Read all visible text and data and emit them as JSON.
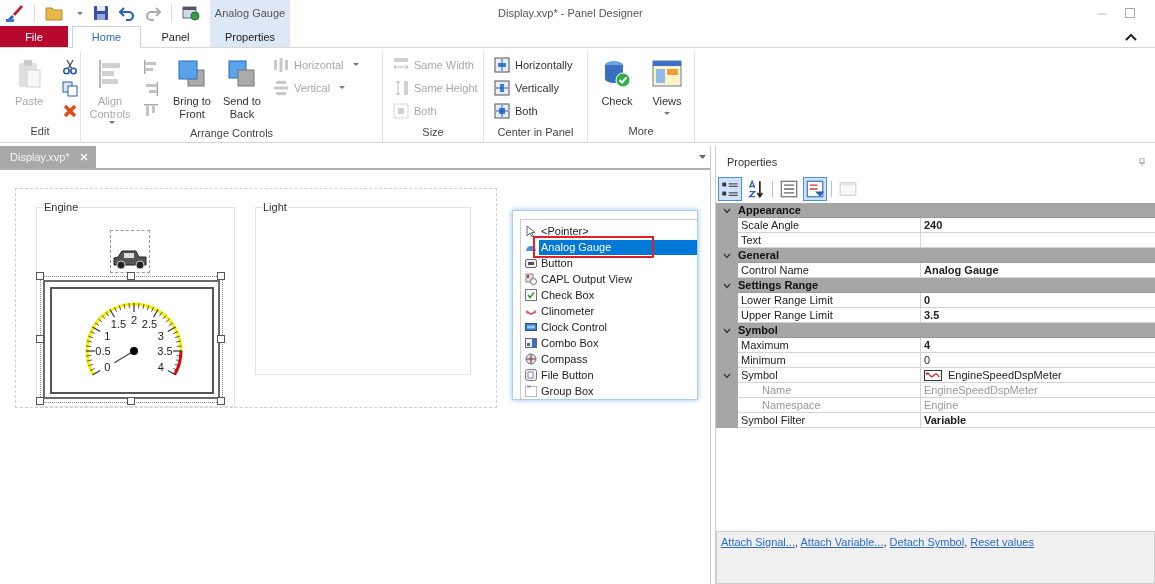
{
  "window": {
    "title": "Display.xvp* - Panel Designer",
    "contextual_tab": "Analog Gauge"
  },
  "ribbon_tabs": [
    {
      "label": "File",
      "kind": "file",
      "selected": false
    },
    {
      "label": "Home",
      "kind": "normal",
      "selected": true
    },
    {
      "label": "Panel",
      "kind": "normal",
      "selected": false
    },
    {
      "label": "Properties",
      "kind": "contextual",
      "selected": false
    }
  ],
  "ribbon_groups": [
    {
      "label": "Edit",
      "columns": [
        [
          {
            "kind": "large",
            "label": "Paste",
            "disabled": true,
            "dropdown": false
          }
        ],
        [
          {
            "kind": "icon",
            "disabled": false
          },
          {
            "kind": "icon",
            "disabled": false
          },
          {
            "kind": "icon",
            "disabled": false
          }
        ]
      ]
    },
    {
      "label": "Arrange Controls",
      "columns": [
        [
          {
            "kind": "large",
            "label": "Align Controls",
            "disabled": true,
            "dropdown": true
          }
        ],
        [
          {
            "kind": "icon",
            "disabled": true
          },
          {
            "kind": "icon",
            "disabled": true
          },
          {
            "kind": "icon",
            "disabled": true
          }
        ],
        [
          {
            "kind": "large",
            "label": "Bring to Front",
            "disabled": false,
            "dropdown": false
          }
        ],
        [
          {
            "kind": "large",
            "label": "Send to Back",
            "disabled": false,
            "dropdown": false
          }
        ],
        [
          {
            "kind": "small",
            "label": "Horizontal",
            "disabled": true,
            "dropdown": true
          },
          {
            "kind": "small",
            "label": "Vertical",
            "disabled": true,
            "dropdown": true
          }
        ]
      ]
    },
    {
      "label": "Size",
      "columns": [
        [
          {
            "kind": "small",
            "label": "Same Width",
            "disabled": true,
            "dropdown": false
          },
          {
            "kind": "small",
            "label": "Same Height",
            "disabled": true,
            "dropdown": false
          },
          {
            "kind": "small",
            "label": "Both",
            "disabled": true,
            "dropdown": false
          }
        ]
      ]
    },
    {
      "label": "Center in Panel",
      "columns": [
        [
          {
            "kind": "small",
            "label": "Horizontally",
            "disabled": false,
            "dropdown": false
          },
          {
            "kind": "small",
            "label": "Vertically",
            "disabled": false,
            "dropdown": false
          },
          {
            "kind": "small",
            "label": "Both",
            "disabled": false,
            "dropdown": false
          }
        ]
      ]
    },
    {
      "label": "More",
      "columns": [
        [
          {
            "kind": "large",
            "label": "Check",
            "disabled": false,
            "dropdown": false
          }
        ],
        [
          {
            "kind": "large",
            "label": "Views",
            "disabled": false,
            "dropdown": true
          }
        ]
      ]
    }
  ],
  "document_tabs": [
    {
      "label": "Display.xvp*",
      "selected": true
    }
  ],
  "group_boxes": [
    {
      "label": "Engine",
      "has_image": true,
      "gauge": {
        "scale_labels": [
          "2",
          "1.5",
          "2.5",
          "1",
          "3",
          "0.5",
          "3.5",
          "0",
          "4"
        ],
        "selected": true
      }
    },
    {
      "label": "Light",
      "has_image": false
    }
  ],
  "toolbox": {
    "items": [
      {
        "label": "<Pointer>",
        "selected": false
      },
      {
        "label": "Analog Gauge",
        "selected": true
      },
      {
        "label": "Button",
        "selected": false
      },
      {
        "label": "CAPL Output View",
        "selected": false
      },
      {
        "label": "Check Box",
        "selected": false
      },
      {
        "label": "Clinometer",
        "selected": false
      },
      {
        "label": "Clock Control",
        "selected": false
      },
      {
        "label": "Combo Box",
        "selected": false
      },
      {
        "label": "Compass",
        "selected": false
      },
      {
        "label": "File Button",
        "selected": false
      },
      {
        "label": "Group Box",
        "selected": false
      }
    ]
  },
  "properties": {
    "title": "Properties",
    "toolbar": [
      {
        "selected": true,
        "disabled": false
      },
      {
        "selected": false,
        "disabled": false
      },
      {
        "selected": false,
        "disabled": false
      },
      {
        "selected": true,
        "disabled": false
      },
      {
        "selected": false,
        "disabled": true
      }
    ],
    "categories": [
      {
        "name": "Appearance",
        "expanded": true,
        "rows": [
          {
            "name": "Scale Angle",
            "value": "240",
            "modified": true,
            "kind": "text"
          },
          {
            "name": "Text",
            "modified": false,
            "kind": "text"
          }
        ]
      },
      {
        "name": "General",
        "expanded": true,
        "rows": [
          {
            "name": "Control Name",
            "value": "Analog Gauge",
            "modified": true,
            "kind": "text"
          }
        ]
      },
      {
        "name": "Settings Range",
        "expanded": true,
        "rows": [
          {
            "name": "Lower Range Limit",
            "value": "0",
            "modified": true,
            "kind": "text"
          },
          {
            "name": "Upper Range Limit",
            "value": "3.5",
            "modified": true,
            "kind": "text"
          }
        ]
      },
      {
        "name": "Symbol",
        "expanded": true,
        "rows": [
          {
            "name": "Maximum",
            "value": "4",
            "modified": true,
            "kind": "text"
          },
          {
            "name": "Minimum",
            "value": "0",
            "modified": false,
            "kind": "text"
          },
          {
            "name": "Symbol",
            "value": "EngineSpeedDspMeter",
            "modified": false,
            "kind": "symbol",
            "expanded": true,
            "children": [
              {
                "name": "Name",
                "value": "EngineSpeedDspMeter",
                "readonly": true
              },
              {
                "name": "Namespace",
                "value": "Engine",
                "readonly": true
              }
            ]
          },
          {
            "name": "Symbol Filter",
            "value": "Variable",
            "modified": true,
            "kind": "text"
          }
        ]
      }
    ],
    "links": [
      {
        "label": "Attach Signal...",
        "suffix": ","
      },
      {
        "label": "Attach Variable...",
        "suffix": ","
      },
      {
        "label": "Detach Symbol",
        "suffix": ","
      },
      {
        "label": "Reset values"
      }
    ]
  }
}
